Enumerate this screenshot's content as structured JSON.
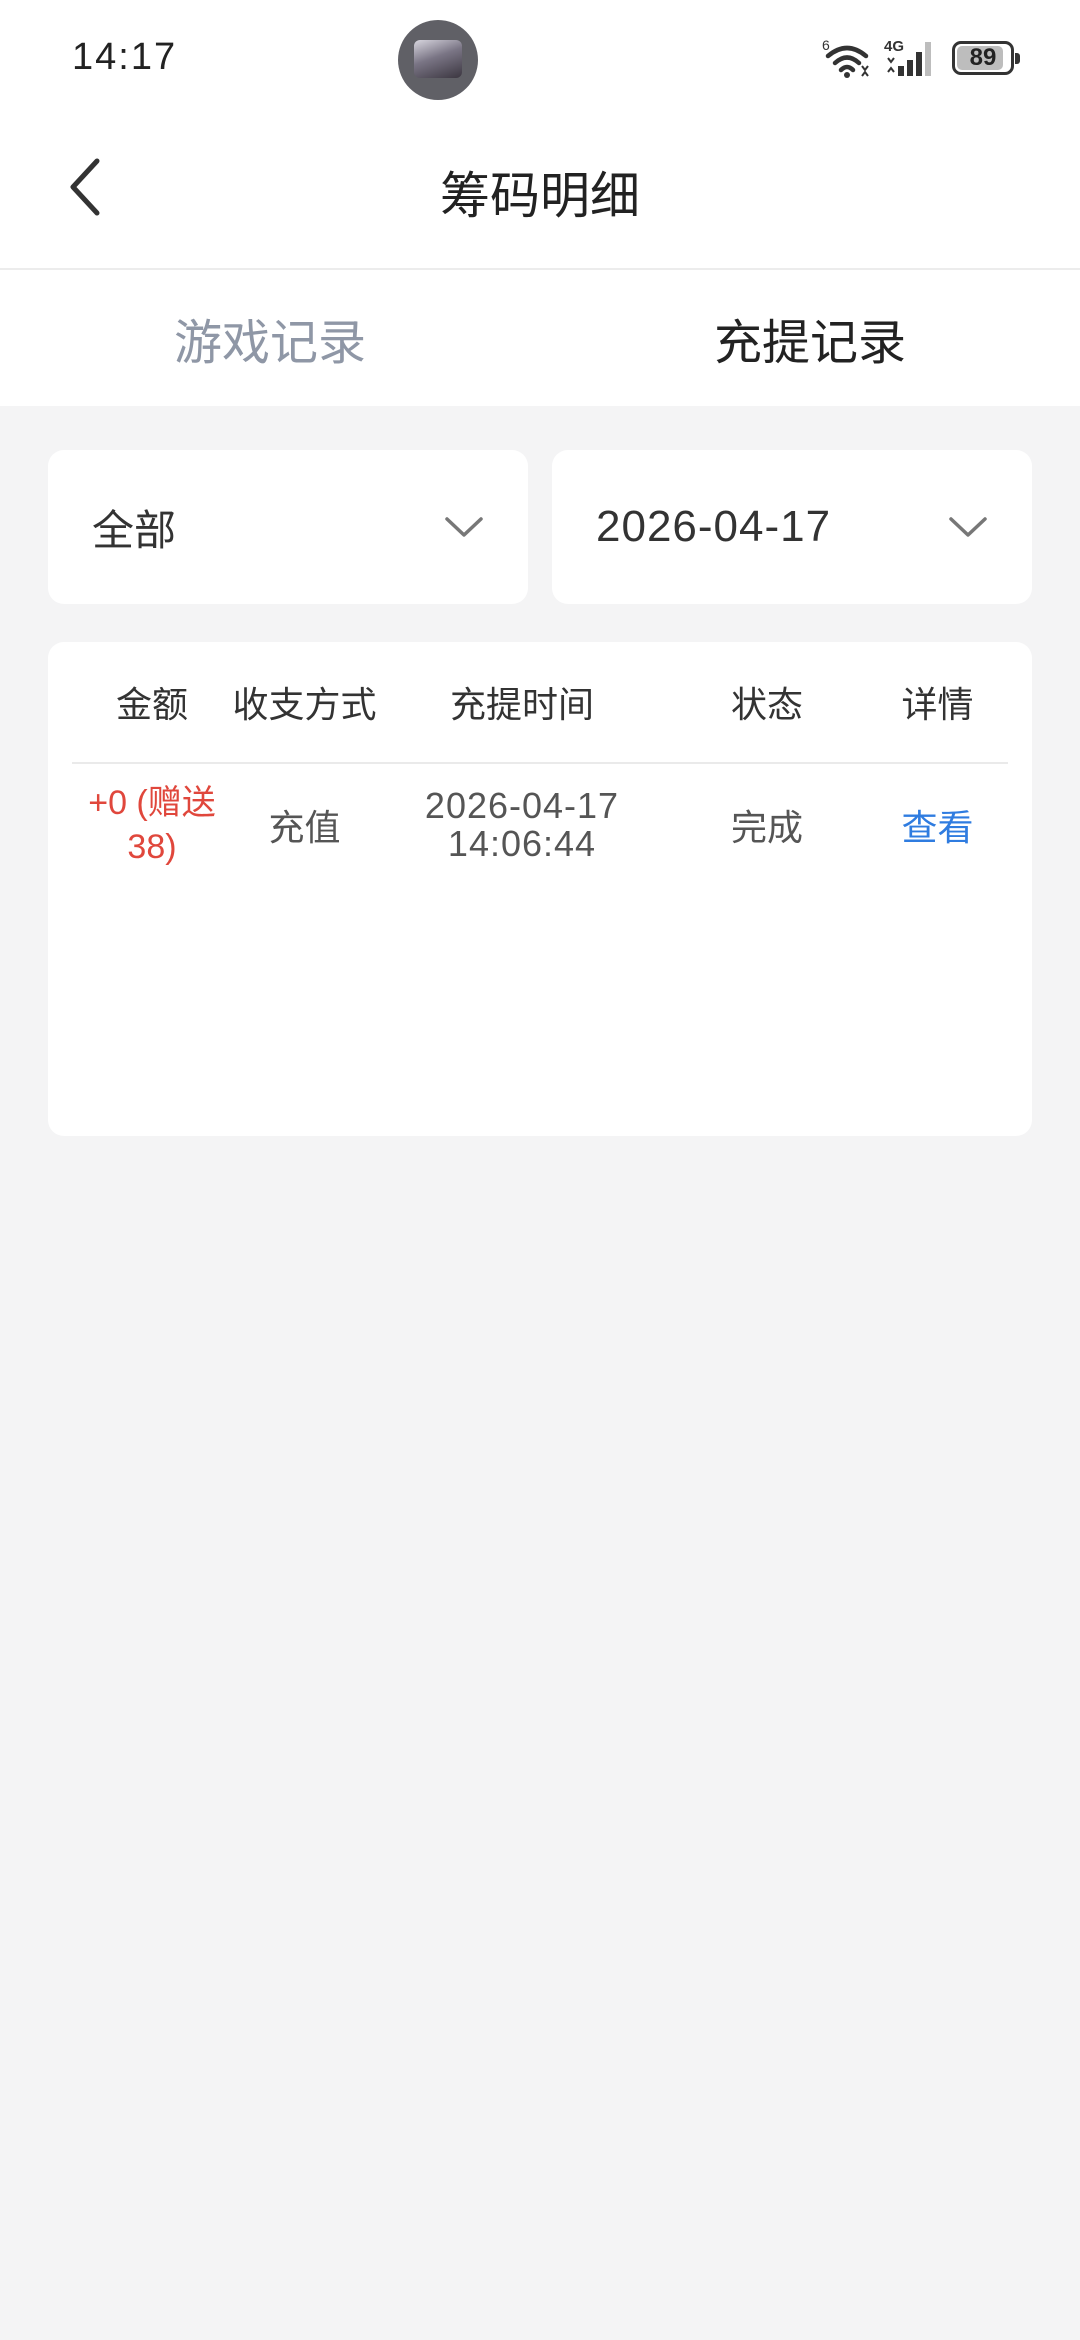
{
  "status_bar": {
    "time": "14:17",
    "signal_label": "4G",
    "wifi_label": "6",
    "battery": "89",
    "battery_level": 89
  },
  "header": {
    "title": "筹码明细"
  },
  "tabs": [
    {
      "label": "游戏记录",
      "active": false
    },
    {
      "label": "充提记录",
      "active": true
    }
  ],
  "filters": {
    "type": "全部",
    "date": "2026-04-17"
  },
  "table": {
    "columns": [
      "金额",
      "收支方式",
      "充提时间",
      "状态",
      "详情"
    ],
    "rows": [
      {
        "amount": "+0 (赠送38)",
        "method": "充值",
        "date": "2026-04-17",
        "time": "14:06:44",
        "status": "完成",
        "detail": "查看"
      }
    ]
  },
  "colors": {
    "background": "#f4f4f5",
    "amount_red": "#e0473c",
    "link_blue": "#2f7ce0",
    "inactive_tab": "#8f97a6"
  }
}
